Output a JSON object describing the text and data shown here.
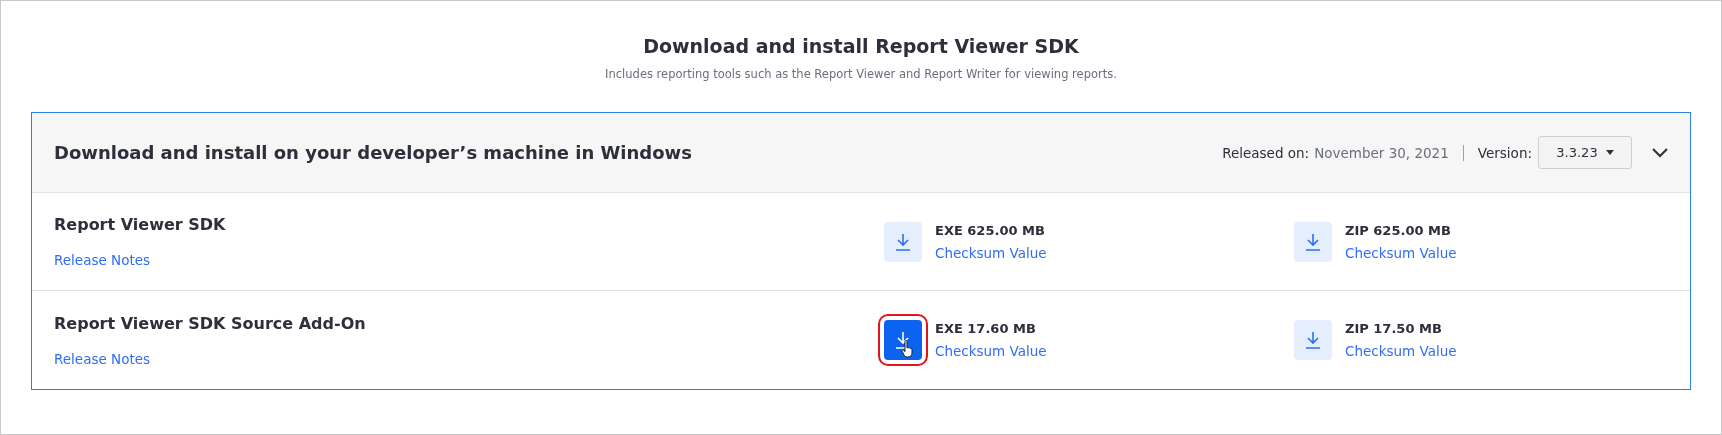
{
  "heading": {
    "title": "Download and install Report Viewer SDK",
    "subtitle": "Includes reporting tools such as the Report Viewer and Report Writer for viewing reports."
  },
  "panel": {
    "title": "Download and install on your developer’s machine in Windows",
    "released_label": "Released on:",
    "released_date": "November 30, 2021",
    "version_label": "Version:",
    "version": "3.3.23",
    "expanded": true
  },
  "products": [
    {
      "name": "Report Viewer SDK",
      "link": "Release Notes",
      "files": [
        {
          "label": "EXE 625.00 MB",
          "link": "Checksum Value",
          "highlighted": false
        },
        {
          "label": "ZIP 625.00 MB",
          "link": "Checksum Value",
          "highlighted": false
        }
      ]
    },
    {
      "name": "Report Viewer SDK Source Add-On",
      "link": "Release Notes",
      "files": [
        {
          "label": "EXE 17.60 MB",
          "link": "Checksum Value",
          "highlighted": true
        },
        {
          "label": "ZIP 17.50 MB",
          "link": "Checksum Value",
          "highlighted": false
        }
      ]
    }
  ]
}
